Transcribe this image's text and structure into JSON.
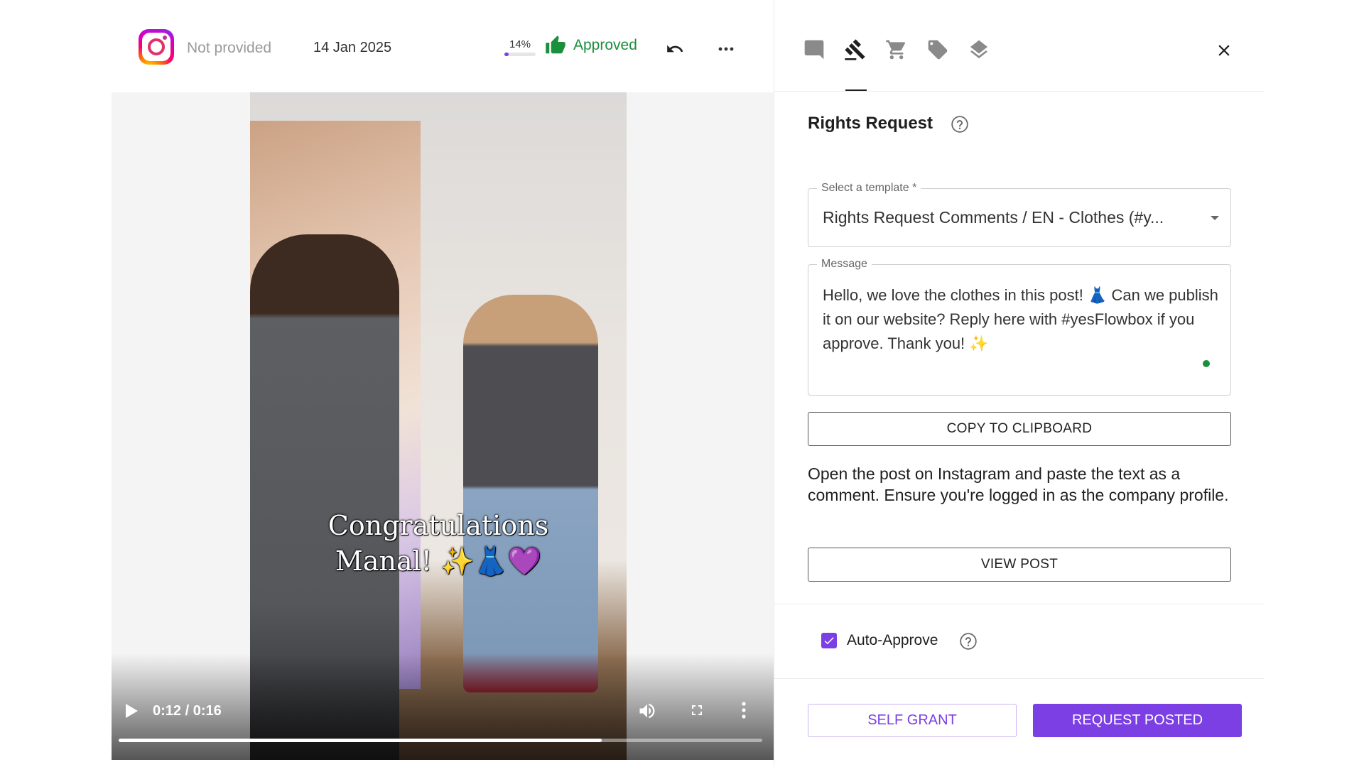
{
  "post": {
    "author": "Not provided",
    "date": "14 Jan 2025",
    "score_label": "14%",
    "score_fraction": 0.14,
    "status": "Approved"
  },
  "video": {
    "caption_line1": "Congratulations",
    "caption_line2": "Manal! ✨👗💜",
    "time": "0:12 / 0:16",
    "progress_fraction": 0.75
  },
  "tabs": [
    "comments",
    "rights",
    "shop",
    "tags",
    "layers"
  ],
  "rights": {
    "title": "Rights Request",
    "template_label": "Select a template *",
    "template_value": "Rights Request Comments / EN - Clothes (#y...",
    "message_label": "Message",
    "message_text": "Hello, we love the clothes in this post! 👗 Can we publish it on our website? Reply here with #yesFlowbox if you approve. Thank you! ✨",
    "copy_button": "COPY TO CLIPBOARD",
    "info_text": "Open the post on Instagram and paste the text as a comment. Ensure you're logged in as the company profile.",
    "view_button": "VIEW POST",
    "auto_approve_label": "Auto-Approve",
    "auto_approve_checked": true,
    "self_grant_button": "SELF GRANT",
    "request_posted_button": "REQUEST POSTED"
  },
  "colors": {
    "accent": "#7b3fe4",
    "approved": "#1a8f3c"
  }
}
